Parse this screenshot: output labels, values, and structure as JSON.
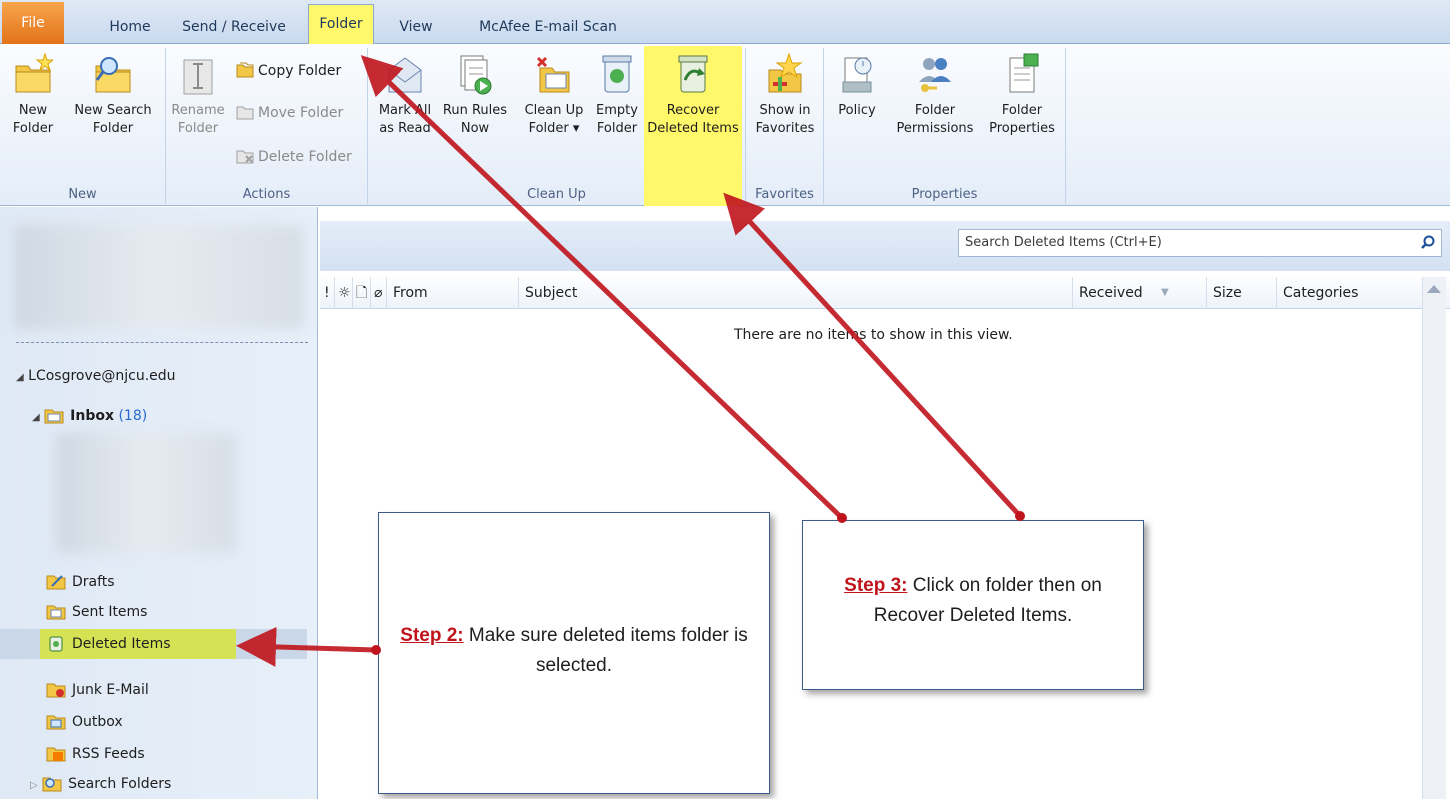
{
  "tabs": {
    "file": "File",
    "home": "Home",
    "send_receive": "Send / Receive",
    "folder": "Folder",
    "view": "View",
    "mcafee": "McAfee E-mail Scan"
  },
  "ribbon": {
    "new": {
      "label": "New",
      "new_folder": "New\nFolder",
      "new_search_folder": "New Search\nFolder"
    },
    "actions": {
      "label": "Actions",
      "rename_folder": "Rename\nFolder",
      "copy_folder": "Copy Folder",
      "move_folder": "Move Folder",
      "delete_folder": "Delete Folder"
    },
    "clean_up": {
      "label": "Clean Up",
      "mark_all_read": "Mark All\nas Read",
      "run_rules": "Run Rules\nNow",
      "clean_up_folder": "Clean Up\nFolder ▾",
      "empty_folder": "Empty\nFolder",
      "recover_deleted": "Recover\nDeleted Items"
    },
    "favorites": {
      "label": "Favorites",
      "show_in_favorites": "Show in\nFavorites"
    },
    "properties": {
      "label": "Properties",
      "policy": "Policy",
      "folder_permissions": "Folder\nPermissions",
      "folder_properties": "Folder\nProperties"
    }
  },
  "nav": {
    "account": "LCosgrove@njcu.edu",
    "inbox": "Inbox",
    "inbox_count": "(18)",
    "folders": [
      "Drafts",
      "Sent Items",
      "Deleted Items",
      "Junk E-Mail",
      "Outbox",
      "RSS Feeds",
      "Search Folders"
    ]
  },
  "list": {
    "search_placeholder": "Search Deleted Items (Ctrl+E)",
    "columns": {
      "importance": "!",
      "reminder": "☼",
      "icon": "🗋",
      "attachment": "⌀",
      "from": "From",
      "subject": "Subject",
      "received": "Received",
      "size": "Size",
      "categories": "Categories"
    },
    "empty_message": "There are no items to show in this view."
  },
  "callouts": {
    "step2_label": "Step 2:",
    "step2_text": " Make sure deleted items folder is selected.",
    "step3_label": "Step 3:",
    "step3_text": " Click on folder then on Recover Deleted Items."
  },
  "colors": {
    "highlight": "#fff86a",
    "file_tab": "#e3731a",
    "arrow": "#c0141c",
    "callout_border": "#3c5a88"
  }
}
